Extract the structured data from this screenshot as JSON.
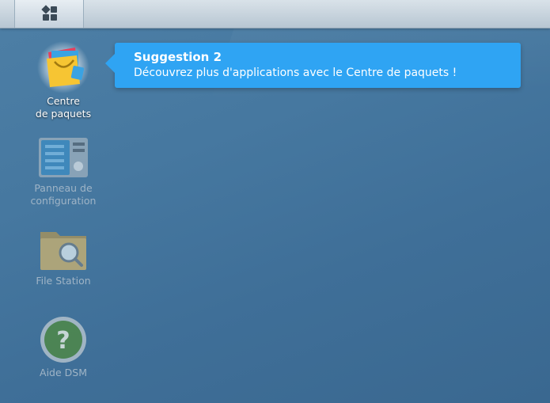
{
  "taskbar": {
    "main_menu_icon": "grid-icon"
  },
  "desktop": {
    "icons": [
      {
        "label_line1": "Centre",
        "label_line2": "de paquets",
        "icon": "package-center-icon",
        "dimmed": false
      },
      {
        "label_line1": "Panneau de",
        "label_line2": "configuration",
        "icon": "control-panel-icon",
        "dimmed": true
      },
      {
        "label_line1": "File Station",
        "icon": "file-station-icon",
        "dimmed": true
      },
      {
        "label_line1": "Aide DSM",
        "icon": "help-icon",
        "dimmed": true
      }
    ]
  },
  "tooltip": {
    "title": "Suggestion 2",
    "text": "Découvrez plus d'applications avec le Centre de paquets !",
    "color": "#2fa4f3"
  }
}
